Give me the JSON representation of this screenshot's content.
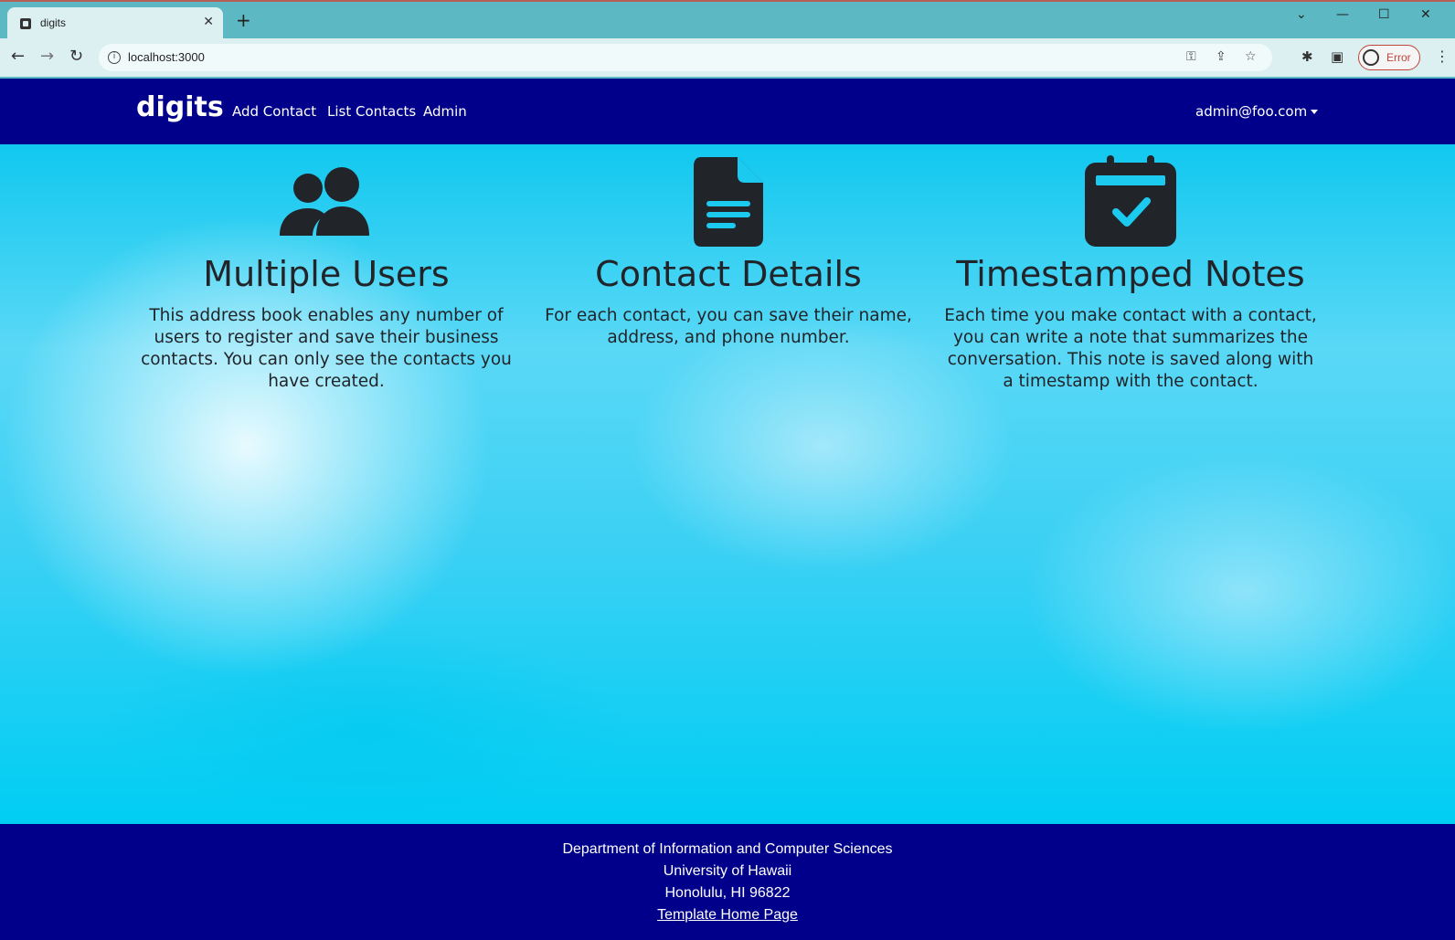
{
  "browser": {
    "tab_title": "digits",
    "url": "localhost:3000",
    "profile_label": "Error"
  },
  "navbar": {
    "brand": "digits",
    "links": [
      {
        "label": "Add Contact"
      },
      {
        "label": "List Contacts"
      },
      {
        "label": "Admin"
      }
    ],
    "user": "admin@foo.com"
  },
  "features": [
    {
      "icon": "users-icon",
      "heading": "Multiple Users",
      "text": "This address book enables any number of users to register and save their business contacts. You can only see the contacts you have created."
    },
    {
      "icon": "file-text-icon",
      "heading": "Contact Details",
      "text": "For each contact, you can save their name, address, and phone number."
    },
    {
      "icon": "calendar-check-icon",
      "heading": "Timestamped Notes",
      "text": "Each time you make contact with a contact, you can write a note that summarizes the conversation. This note is saved along with a timestamp with the contact."
    }
  ],
  "footer": {
    "line1": "Department of Information and Computer Sciences",
    "line2": "University of Hawaii",
    "line3": "Honolulu, HI 96822",
    "link": "Template Home Page"
  },
  "colors": {
    "navbar_bg": "#00008b",
    "footer_bg": "#00008b",
    "text_dark": "#212529",
    "browser_frame": "#5cb8c2"
  }
}
